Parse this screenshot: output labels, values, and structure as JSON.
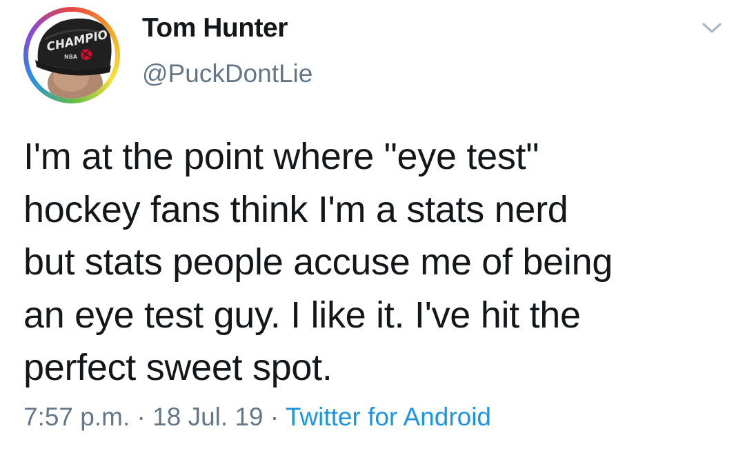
{
  "user": {
    "name": "Tom Hunter",
    "handle": "@PuckDontLie",
    "avatar_cap_text": "CHAMPIO",
    "avatar_cap_logo": "NBA"
  },
  "tweet": {
    "lines": [
      "I'm at the point where \"eye test\"",
      "hockey fans think I'm a stats nerd",
      "but stats people accuse me of being",
      "an eye test guy. I like it. I've hit the",
      "perfect sweet spot."
    ]
  },
  "meta": {
    "time": "7:57 p.m.",
    "separator1": " · ",
    "date": "18 Jul. 19",
    "separator2": " · ",
    "source": "Twitter for Android"
  },
  "icons": {
    "more": "chevron-down-icon"
  },
  "colors": {
    "text": "#14171a",
    "secondary": "#657786",
    "link": "#1b95e0"
  }
}
